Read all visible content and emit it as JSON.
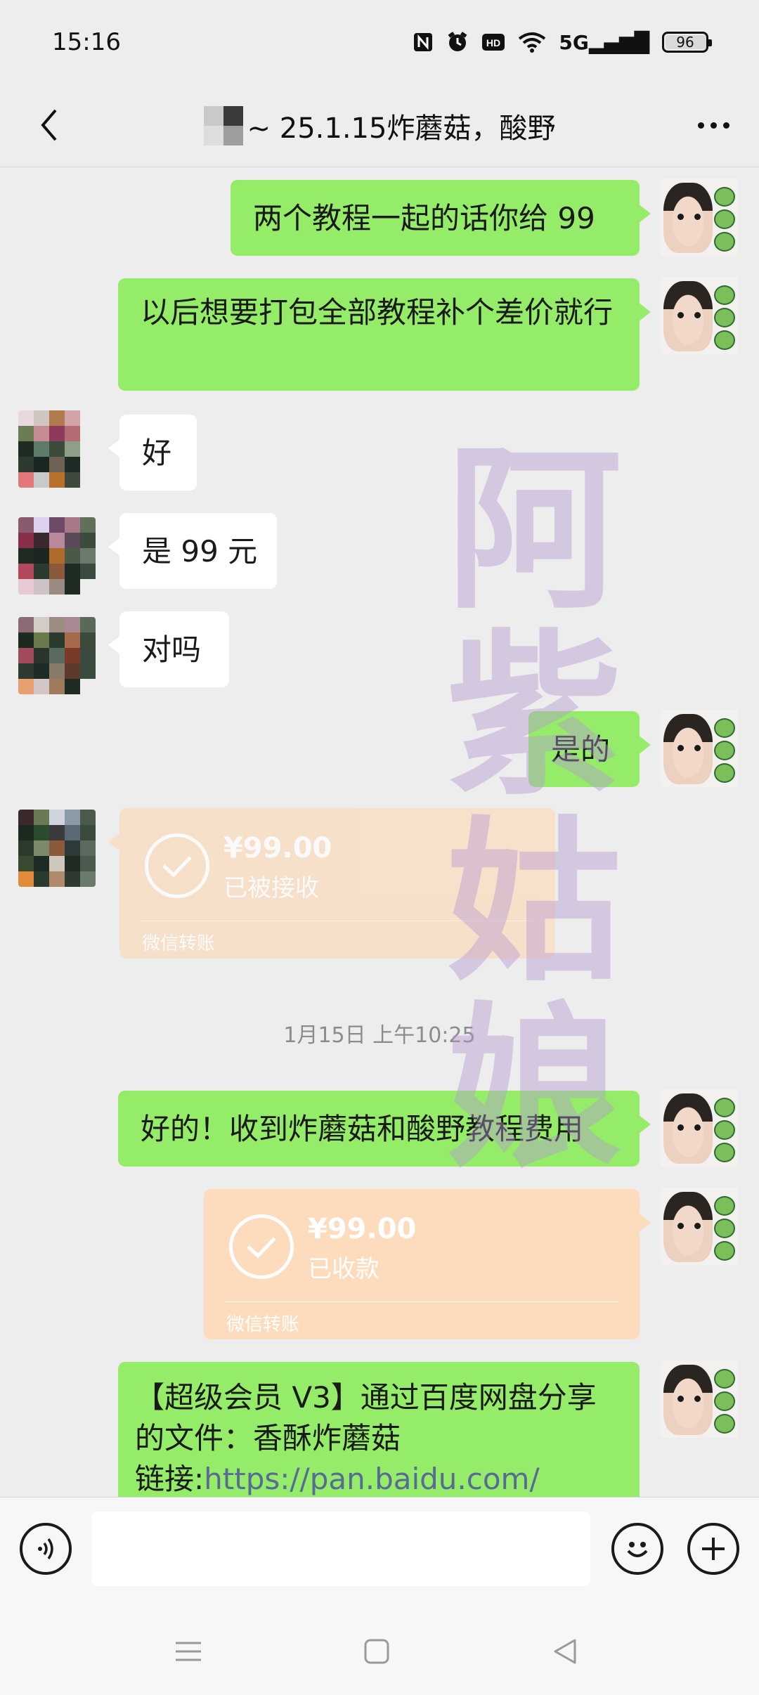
{
  "status_bar": {
    "time": "15:16",
    "icons": [
      "nfc-icon",
      "alarm-icon",
      "hd-icon",
      "wifi-icon",
      "5g-signal-icon"
    ],
    "network": "5G",
    "battery": "96"
  },
  "header": {
    "title": "~ 25.1.15炸蘑菇，酸野",
    "back_icon": "chevron-left-icon",
    "more_icon": "more-dots-icon"
  },
  "watermark": {
    "chars": [
      "阿",
      "紫",
      "姑",
      "娘"
    ]
  },
  "messages": [
    {
      "side": "me",
      "type": "text",
      "text": "两个教程一起的话你给 99"
    },
    {
      "side": "me",
      "type": "text",
      "text": "以后想要打包全部教程补个差价就行"
    },
    {
      "side": "other",
      "type": "text",
      "text": "好"
    },
    {
      "side": "other",
      "type": "text",
      "text": "是 99 元"
    },
    {
      "side": "other",
      "type": "text",
      "text": "对吗"
    },
    {
      "side": "me",
      "type": "text",
      "text": "是的"
    },
    {
      "side": "other",
      "type": "transfer",
      "amount": "¥99.00",
      "status": "已被接收",
      "footer": "微信转账"
    },
    {
      "type": "timestamp",
      "text": "1月15日 上午10:25"
    },
    {
      "side": "me",
      "type": "text",
      "text": "好的！收到炸蘑菇和酸野教程费用"
    },
    {
      "side": "me",
      "type": "transfer",
      "amount": "¥99.00",
      "status": "已收款",
      "footer": "微信转账"
    },
    {
      "side": "me",
      "type": "text",
      "text": "【超级会员 V3】通过百度网盘分享的文件：香酥炸蘑菇",
      "link_label": "链接:",
      "link": "https://pan.baidu.com/"
    }
  ],
  "input_bar": {
    "voice_icon": "voice-icon",
    "emoji_icon": "emoji-icon",
    "plus_icon": "plus-icon",
    "placeholder": ""
  },
  "nav_bar": {
    "icons": [
      "menu-icon",
      "home-square-icon",
      "back-triangle-icon"
    ]
  },
  "colors": {
    "background": "#ededed",
    "bubble_me": "#95ec69",
    "bubble_other": "#ffffff",
    "transfer": "#fcdcbc",
    "link": "#576b95",
    "watermark": "#b296d2"
  }
}
